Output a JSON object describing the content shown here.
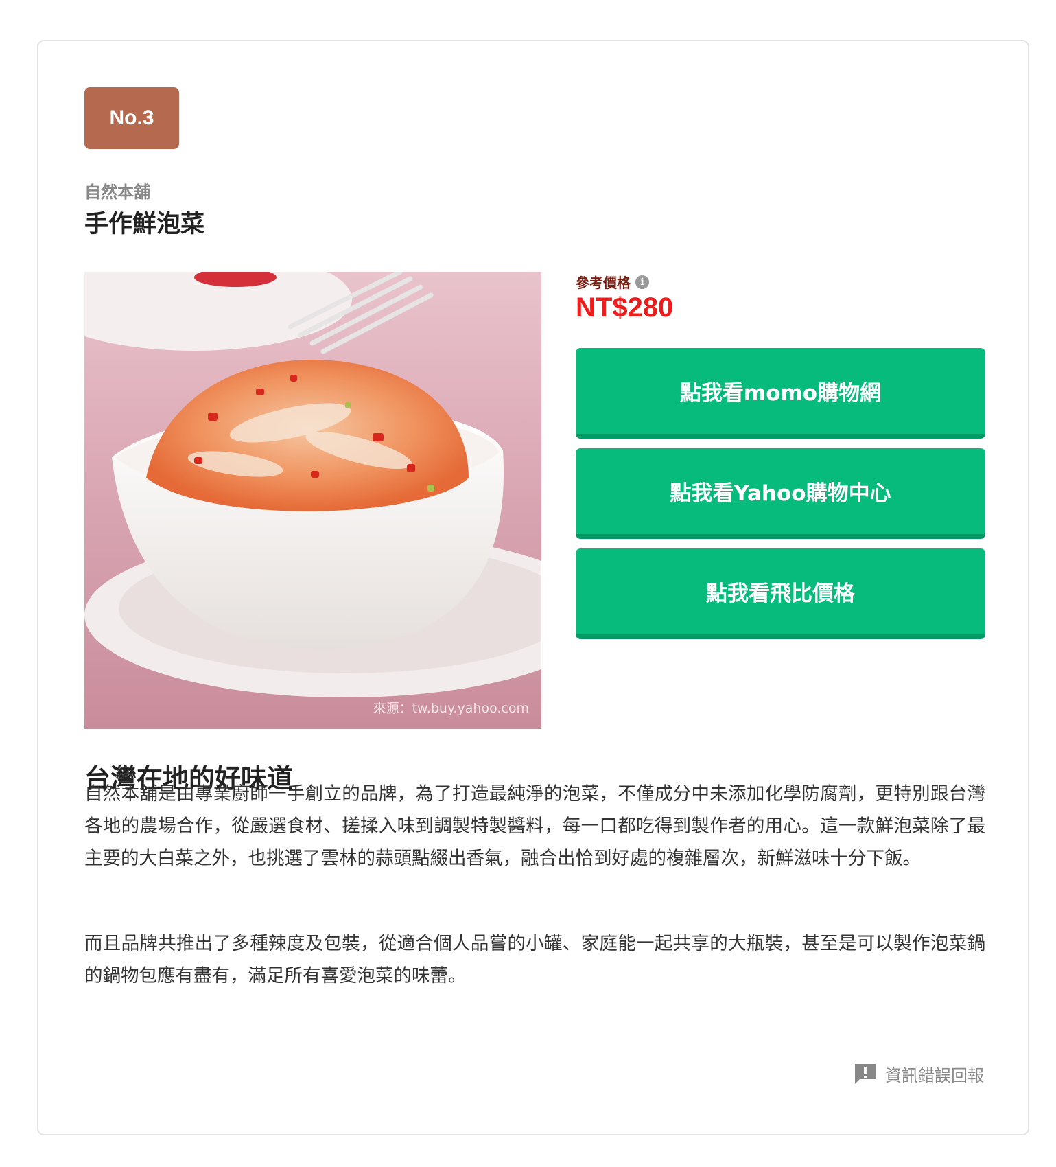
{
  "rank_label": "No.3",
  "brand": "自然本舖",
  "product_name": "手作鮮泡菜",
  "image": {
    "alt": "手作鮮泡菜",
    "source_credit": "來源：tw.buy.yahoo.com"
  },
  "price": {
    "label": "參考價格",
    "info_icon": "info-icon",
    "value": "NT$280"
  },
  "shop_buttons": [
    {
      "label": "點我看momo購物網"
    },
    {
      "label": "點我看Yahoo購物中心"
    },
    {
      "label": "點我看飛比價格"
    }
  ],
  "section_title": "台灣在地的好味道",
  "paragraphs": [
    "自然本舖是由專業廚師一手創立的品牌，為了打造最純淨的泡菜，不僅成分中未添加化學防腐劑，更特別跟台灣各地的農場合作，從嚴選食材、搓揉入味到調製特製醬料，每一口都吃得到製作者的用心。這一款鮮泡菜除了最主要的大白菜之外，也挑選了雲林的蒜頭點綴出香氣，融合出恰到好處的複雜層次，新鮮滋味十分下飯。",
    "而且品牌共推出了多種辣度及包裝，從適合個人品嘗的小罐、家庭能一起共享的大瓶裝，甚至是可以製作泡菜鍋的鍋物包應有盡有，滿足所有喜愛泡菜的味蕾。"
  ],
  "report": {
    "icon": "feedback-icon",
    "label": "資訊錯誤回報"
  },
  "colors": {
    "rank_badge": "#b5694f",
    "price": "#ee1d1d",
    "button": "#07bb7d",
    "button_shadow": "#049a66"
  }
}
